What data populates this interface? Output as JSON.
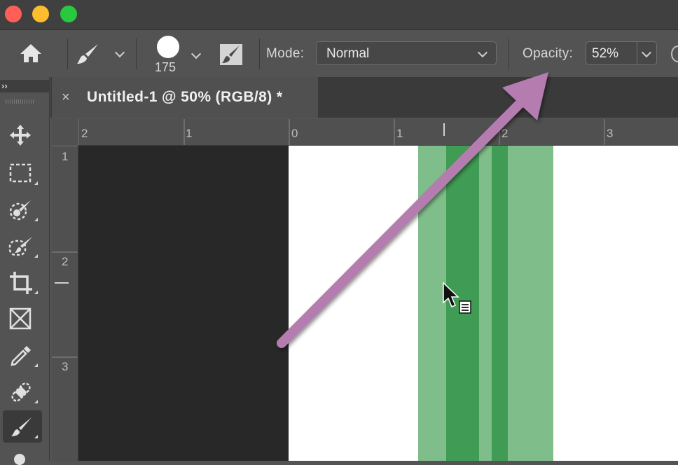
{
  "window": {
    "traffic_lights": [
      "#ff5f57",
      "#febc2e",
      "#28c840"
    ]
  },
  "options_bar": {
    "brush_size": "175",
    "mode_label": "Mode:",
    "mode_value": "Normal",
    "opacity_label": "Opacity:",
    "opacity_value": "52%"
  },
  "document_tab": {
    "close": "×",
    "title": "Untitled-1 @ 50% (RGB/8) *"
  },
  "rulers": {
    "horizontal_ticks": [
      "2",
      "1",
      "0",
      "1",
      "2",
      "3"
    ],
    "vertical_ticks": [
      "1",
      "2",
      "3"
    ]
  },
  "colors": {
    "stroke_light": "#7fbe8a",
    "stroke_dark": "#409c54",
    "annotation_arrow": "#b57cb0",
    "canvas_dark": "#282828"
  },
  "icons": [
    "home-icon",
    "brush-icon",
    "brush-tip-icon",
    "brush-settings-icon",
    "move-icon",
    "marquee-icon",
    "quick-selection-icon",
    "object-selection-icon",
    "crop-icon",
    "frame-icon",
    "eyedropper-icon",
    "healing-brush-icon",
    "brush-tool-icon",
    "cursor-icon"
  ]
}
